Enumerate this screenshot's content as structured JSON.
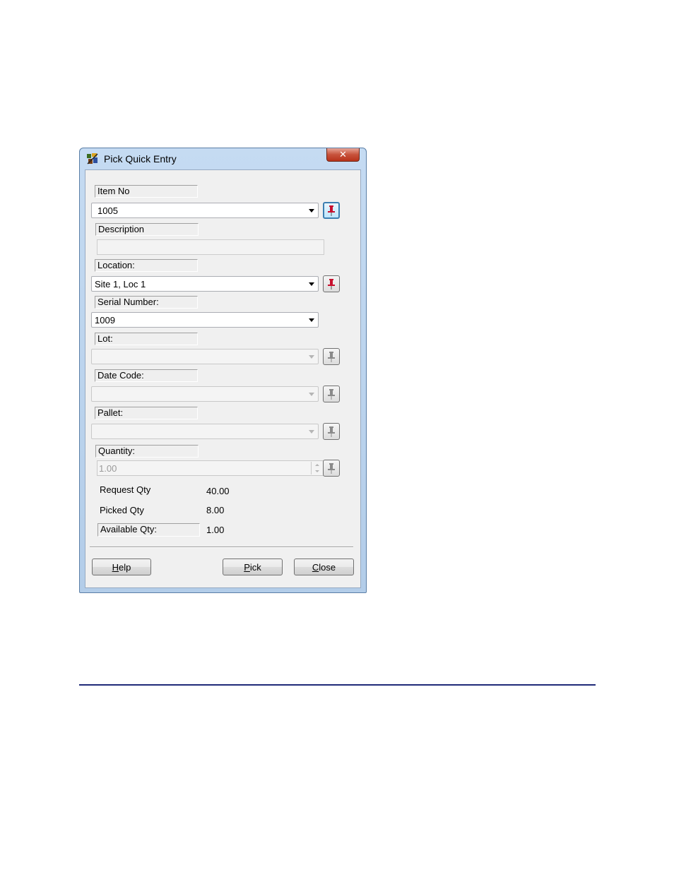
{
  "window": {
    "title": "Pick Quick Entry",
    "close_glyph": "✕",
    "app_icon": "pick-app-icon",
    "close_icon": "close-icon"
  },
  "fields": {
    "item_no": {
      "label": "Item No",
      "value": "1005",
      "pin_active": true
    },
    "description": {
      "label": "Description",
      "value": ""
    },
    "location": {
      "label": "Location:",
      "value": "Site 1, Loc 1",
      "pin_active": true
    },
    "serial_number": {
      "label": "Serial Number:",
      "value": "1009"
    },
    "lot": {
      "label": "Lot:",
      "value": "",
      "disabled": true
    },
    "date_code": {
      "label": "Date Code:",
      "value": "",
      "disabled": true
    },
    "pallet": {
      "label": "Pallet:",
      "value": "",
      "disabled": true
    },
    "quantity": {
      "label": "Quantity:",
      "value": "1.00",
      "disabled": true
    }
  },
  "summary": {
    "request_qty": {
      "label": "Request Qty",
      "value": "40.00"
    },
    "picked_qty": {
      "label": "Picked Qty",
      "value": "8.00"
    },
    "available_qty": {
      "label": "Available Qty:",
      "value": "1.00"
    }
  },
  "buttons": {
    "help": "Help",
    "pick": "Pick",
    "close": "Close"
  },
  "colors": {
    "pin_active": "#c8102e",
    "pin_inactive": "#8a8a8a",
    "rule": "#1f2a78"
  }
}
